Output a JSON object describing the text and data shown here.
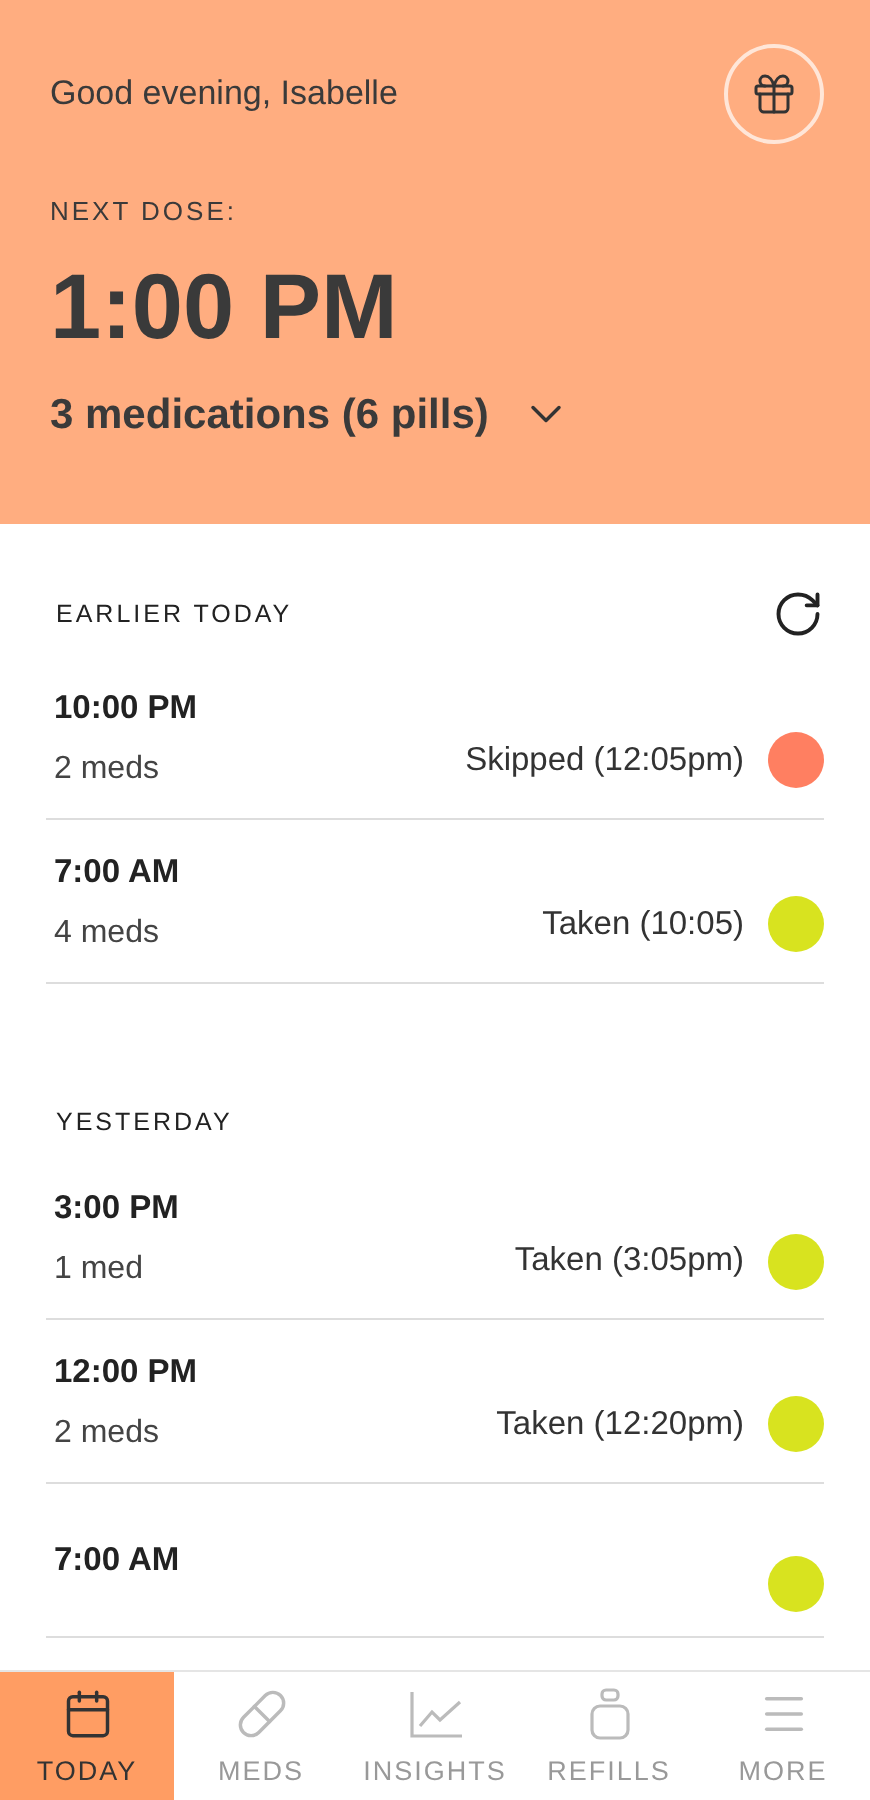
{
  "header": {
    "greeting": "Good evening, Isabelle",
    "next_dose_label": "NEXT DOSE:",
    "next_dose_time": "1:00 PM",
    "next_dose_summary": "3 medications (6 pills)"
  },
  "sections": [
    {
      "title": "EARLIER TODAY",
      "refresh": true,
      "doses": [
        {
          "time": "10:00 PM",
          "count": "2 meds",
          "status": "Skipped (12:05pm)",
          "color": "#ff7f61"
        },
        {
          "time": "7:00 AM",
          "count": "4 meds",
          "status": "Taken (10:05)",
          "color": "#d8e31f"
        }
      ]
    },
    {
      "title": "YESTERDAY",
      "refresh": false,
      "doses": [
        {
          "time": "3:00 PM",
          "count": "1 med",
          "status": "Taken (3:05pm)",
          "color": "#d8e31f"
        },
        {
          "time": "12:00 PM",
          "count": "2 meds",
          "status": "Taken (12:20pm)",
          "color": "#d8e31f"
        },
        {
          "time": "7:00 AM",
          "color": "#d8e31f"
        }
      ]
    }
  ],
  "nav": [
    {
      "kind": "today",
      "label": "TODAY",
      "selected": true
    },
    {
      "kind": "meds",
      "label": "MEDS",
      "selected": false
    },
    {
      "kind": "insights",
      "label": "INSIGHTS",
      "selected": false
    },
    {
      "kind": "refills",
      "label": "REFILLS",
      "selected": false
    },
    {
      "kind": "more",
      "label": "MORE",
      "selected": false
    }
  ]
}
